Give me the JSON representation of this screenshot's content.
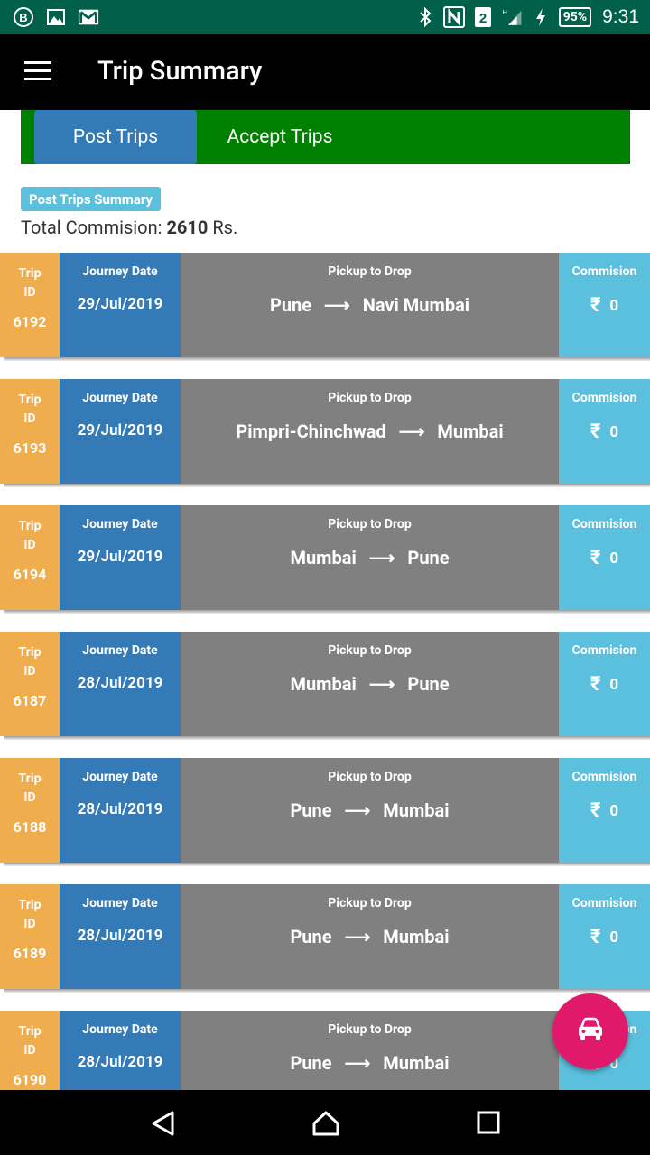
{
  "app": {
    "title": "Trip Summary"
  },
  "status_bar": {
    "time": "9:31",
    "battery": "95%",
    "sim": "2",
    "left_icons": [
      "b-circle-icon",
      "image-icon",
      "gmail-icon"
    ],
    "right_icons": [
      "bluetooth-icon",
      "nfc-icon",
      "sim-icon",
      "signal-icon",
      "charging-icon",
      "battery-icon"
    ]
  },
  "tabs": [
    {
      "label": "Post Trips",
      "active": true
    },
    {
      "label": "Accept Trips",
      "active": false
    }
  ],
  "summary": {
    "badge": "Post Trips Summary",
    "total_label": "Total Commision:",
    "total_value": "2610",
    "total_unit": "Rs."
  },
  "headers": {
    "trip_id_line1": "Trip",
    "trip_id_line2": "ID",
    "journey_date": "Journey Date",
    "pickup_to_drop": "Pickup to Drop",
    "commission": "Commision"
  },
  "trips": [
    {
      "id": "6192",
      "date": "29/Jul/2019",
      "from": "Pune",
      "to": "Navi Mumbai",
      "commission": "0"
    },
    {
      "id": "6193",
      "date": "29/Jul/2019",
      "from": "Pimpri-Chinchwad",
      "to": "Mumbai",
      "commission": "0"
    },
    {
      "id": "6194",
      "date": "29/Jul/2019",
      "from": "Mumbai",
      "to": "Pune",
      "commission": "0"
    },
    {
      "id": "6187",
      "date": "28/Jul/2019",
      "from": "Mumbai",
      "to": "Pune",
      "commission": "0"
    },
    {
      "id": "6188",
      "date": "28/Jul/2019",
      "from": "Pune",
      "to": "Mumbai",
      "commission": "0"
    },
    {
      "id": "6189",
      "date": "28/Jul/2019",
      "from": "Pune",
      "to": "Mumbai",
      "commission": "0"
    },
    {
      "id": "6190",
      "date": "28/Jul/2019",
      "from": "Pune",
      "to": "Mumbai",
      "commission": "0"
    }
  ],
  "symbols": {
    "arrow": "⟶",
    "rupee": "₹"
  },
  "fab": {
    "icon": "car-icon",
    "color": "#e0196a"
  },
  "colors": {
    "status_bar": "#00604a",
    "toolbar": "#000000",
    "tabs_bg": "#008000",
    "tab_active": "#337ab7",
    "trip_id": "#f0ad4e",
    "journey_date": "#337ab7",
    "route": "#808080",
    "commission": "#5bc0de"
  }
}
